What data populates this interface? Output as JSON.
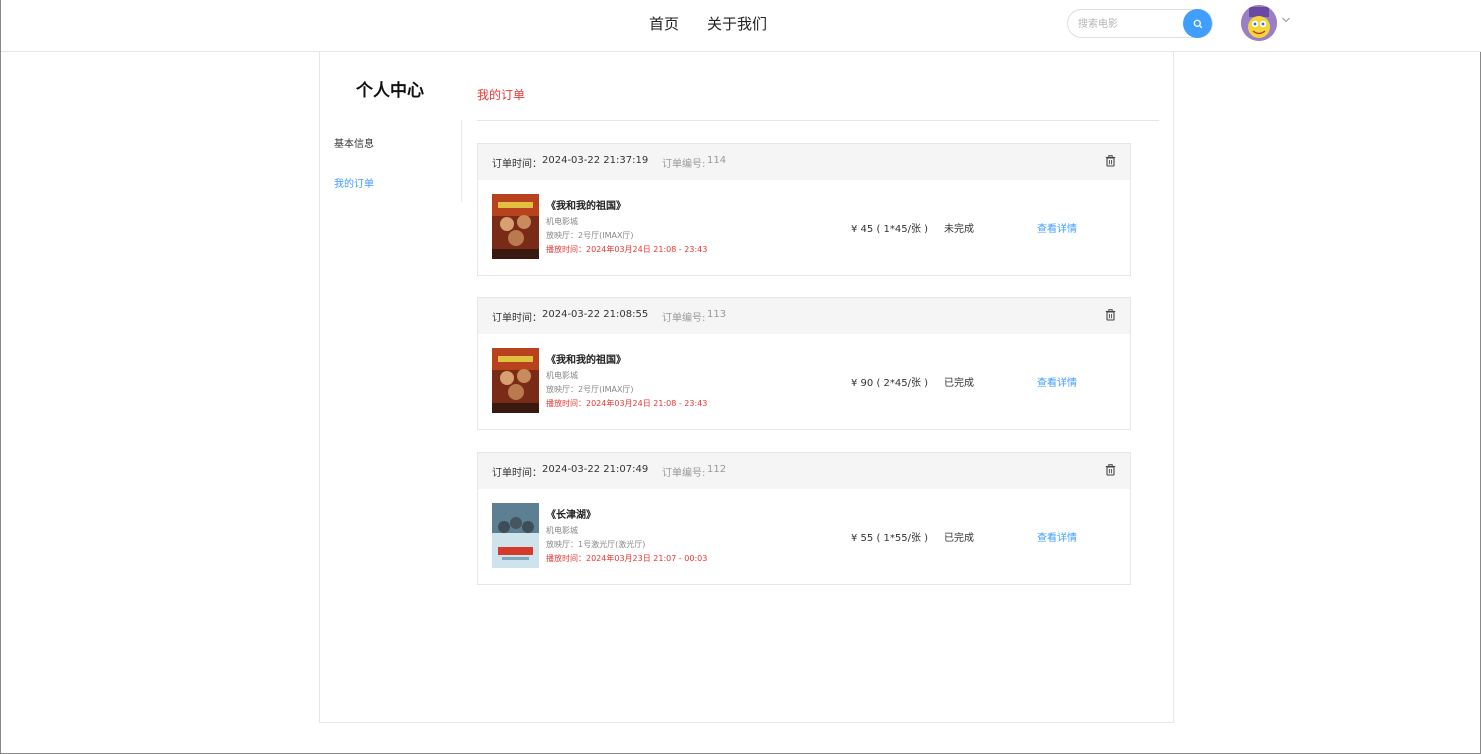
{
  "header": {
    "nav": [
      "首页",
      "关于我们"
    ],
    "search_placeholder": "搜索电影",
    "icons": {
      "search": "search-icon",
      "avatar": "user-avatar",
      "dropdown": "chevron-down-icon"
    }
  },
  "sidebar": {
    "title": "个人中心",
    "items": [
      {
        "label": "基本信息",
        "active": false
      },
      {
        "label": "我的订单",
        "active": true
      }
    ]
  },
  "main": {
    "title": "我的订单",
    "time_label": "订单时间：",
    "no_label": "订单编号:",
    "orders": [
      {
        "time": "2024-03-22 21:37:19",
        "no": "114",
        "movie": "《我和我的祖国》",
        "cinema": "机电影城",
        "hall": "放映厅：2号厅(IMAX厅)",
        "showtime": "播放时间：2024年03月24日 21:08 - 23:43",
        "price": "¥ 45 ( 1*45/张 )",
        "status": "未完成",
        "detail": "查看详情"
      },
      {
        "time": "2024-03-22 21:08:55",
        "no": "113",
        "movie": "《我和我的祖国》",
        "cinema": "机电影城",
        "hall": "放映厅：2号厅(IMAX厅)",
        "showtime": "播放时间：2024年03月24日 21:08 - 23:43",
        "price": "¥ 90 ( 2*45/张 )",
        "status": "已完成",
        "detail": "查看详情"
      },
      {
        "time": "2024-03-22 21:07:49",
        "no": "112",
        "movie": "《长津湖》",
        "cinema": "机电影城",
        "hall": "放映厅：1号激光厅(激光厅)",
        "showtime": "播放时间：2024年03月23日 21:07 - 00:03",
        "price": "¥ 55 ( 1*55/张 )",
        "status": "已完成",
        "detail": "查看详情"
      }
    ]
  },
  "colors": {
    "accent": "#409eff",
    "red": "#e53935",
    "border": "#e6e6e6",
    "head_bg": "#f5f5f5"
  }
}
